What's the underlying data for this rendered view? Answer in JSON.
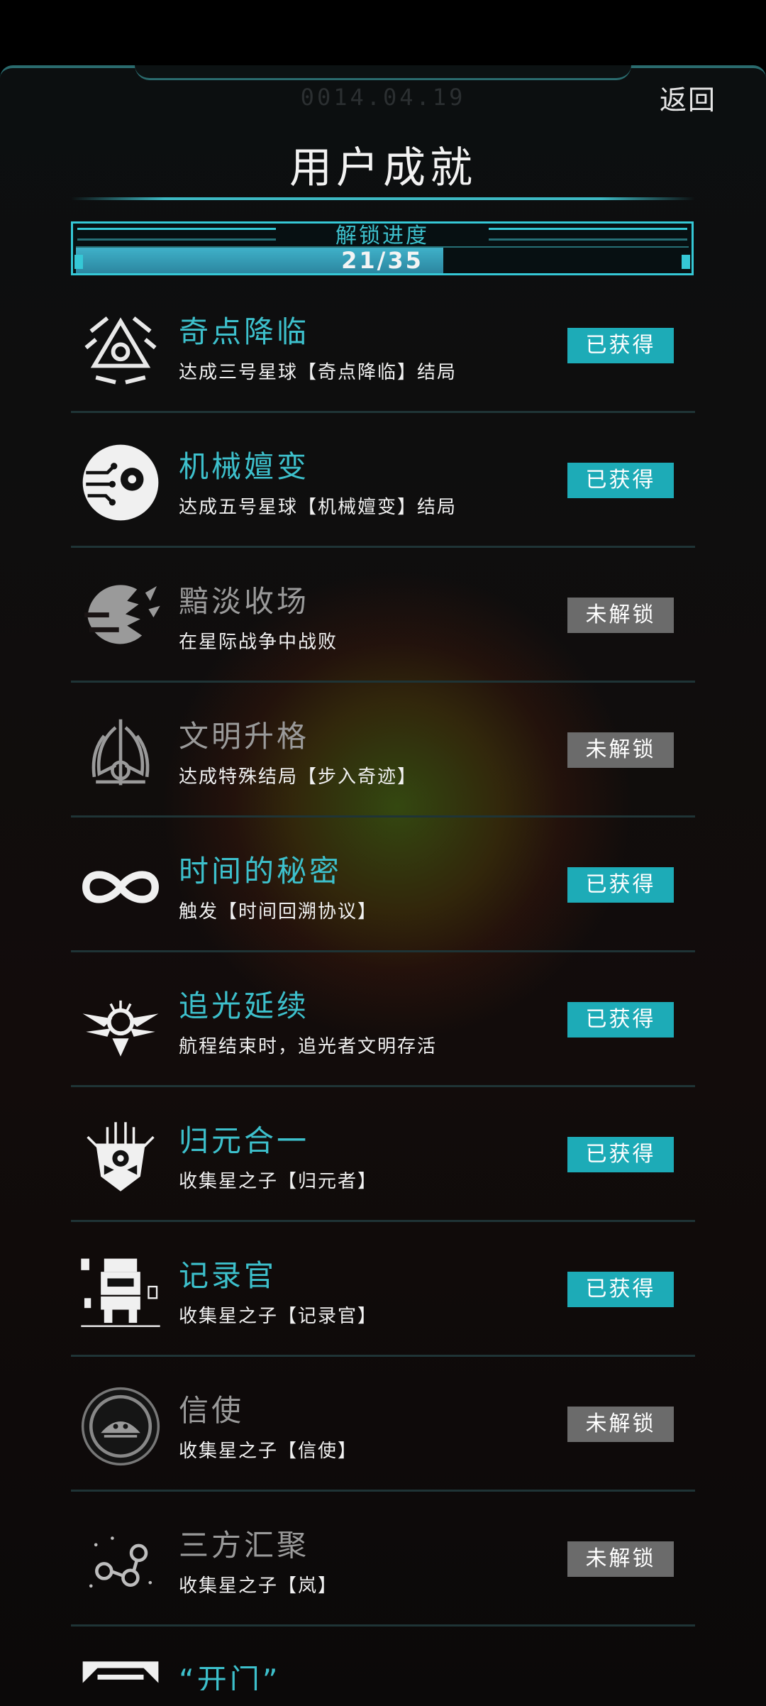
{
  "header": {
    "date": "0014.04.19",
    "back_label": "返回",
    "title": "用户成就"
  },
  "progress": {
    "label": "解锁进度",
    "text": "21/35",
    "fraction": 0.6
  },
  "colors": {
    "accent": "#3dc0cc",
    "badge_unlocked": "#1dabb7",
    "badge_locked": "#6b6b6b"
  },
  "achievements": [
    {
      "name": "奇点降临",
      "desc": "达成三号星球【奇点降临】结局",
      "status": "已获得",
      "unlocked": true,
      "icon": "triangle-emblem-icon"
    },
    {
      "name": "机械嬗变",
      "desc": "达成五号星球【机械嬗变】结局",
      "status": "已获得",
      "unlocked": true,
      "icon": "circuit-eye-icon"
    },
    {
      "name": "黯淡收场",
      "desc": "在星际战争中战败",
      "status": "未解锁",
      "unlocked": false,
      "icon": "broken-planet-icon"
    },
    {
      "name": "文明升格",
      "desc": "达成特殊结局【步入奇迹】",
      "status": "未解锁",
      "unlocked": false,
      "icon": "winged-crest-icon"
    },
    {
      "name": "时间的秘密",
      "desc": "触发【时间回溯协议】",
      "status": "已获得",
      "unlocked": true,
      "icon": "infinity-icon"
    },
    {
      "name": "追光延续",
      "desc": "航程结束时，追光者文明存活",
      "status": "已获得",
      "unlocked": true,
      "icon": "winged-star-icon"
    },
    {
      "name": "归元合一",
      "desc": "收集星之子【归元者】",
      "status": "已获得",
      "unlocked": true,
      "icon": "robot-mask-icon"
    },
    {
      "name": "记录官",
      "desc": "收集星之子【记录官】",
      "status": "已获得",
      "unlocked": true,
      "icon": "pixel-robot-icon"
    },
    {
      "name": "信使",
      "desc": "收集星之子【信使】",
      "status": "未解锁",
      "unlocked": false,
      "icon": "messenger-ship-icon"
    },
    {
      "name": "三方汇聚",
      "desc": "收集星之子【岚】",
      "status": "未解锁",
      "unlocked": false,
      "icon": "orbit-nodes-icon"
    },
    {
      "name": "“开门”",
      "desc": "",
      "status": "",
      "unlocked": true,
      "icon": "gate-icon"
    }
  ]
}
